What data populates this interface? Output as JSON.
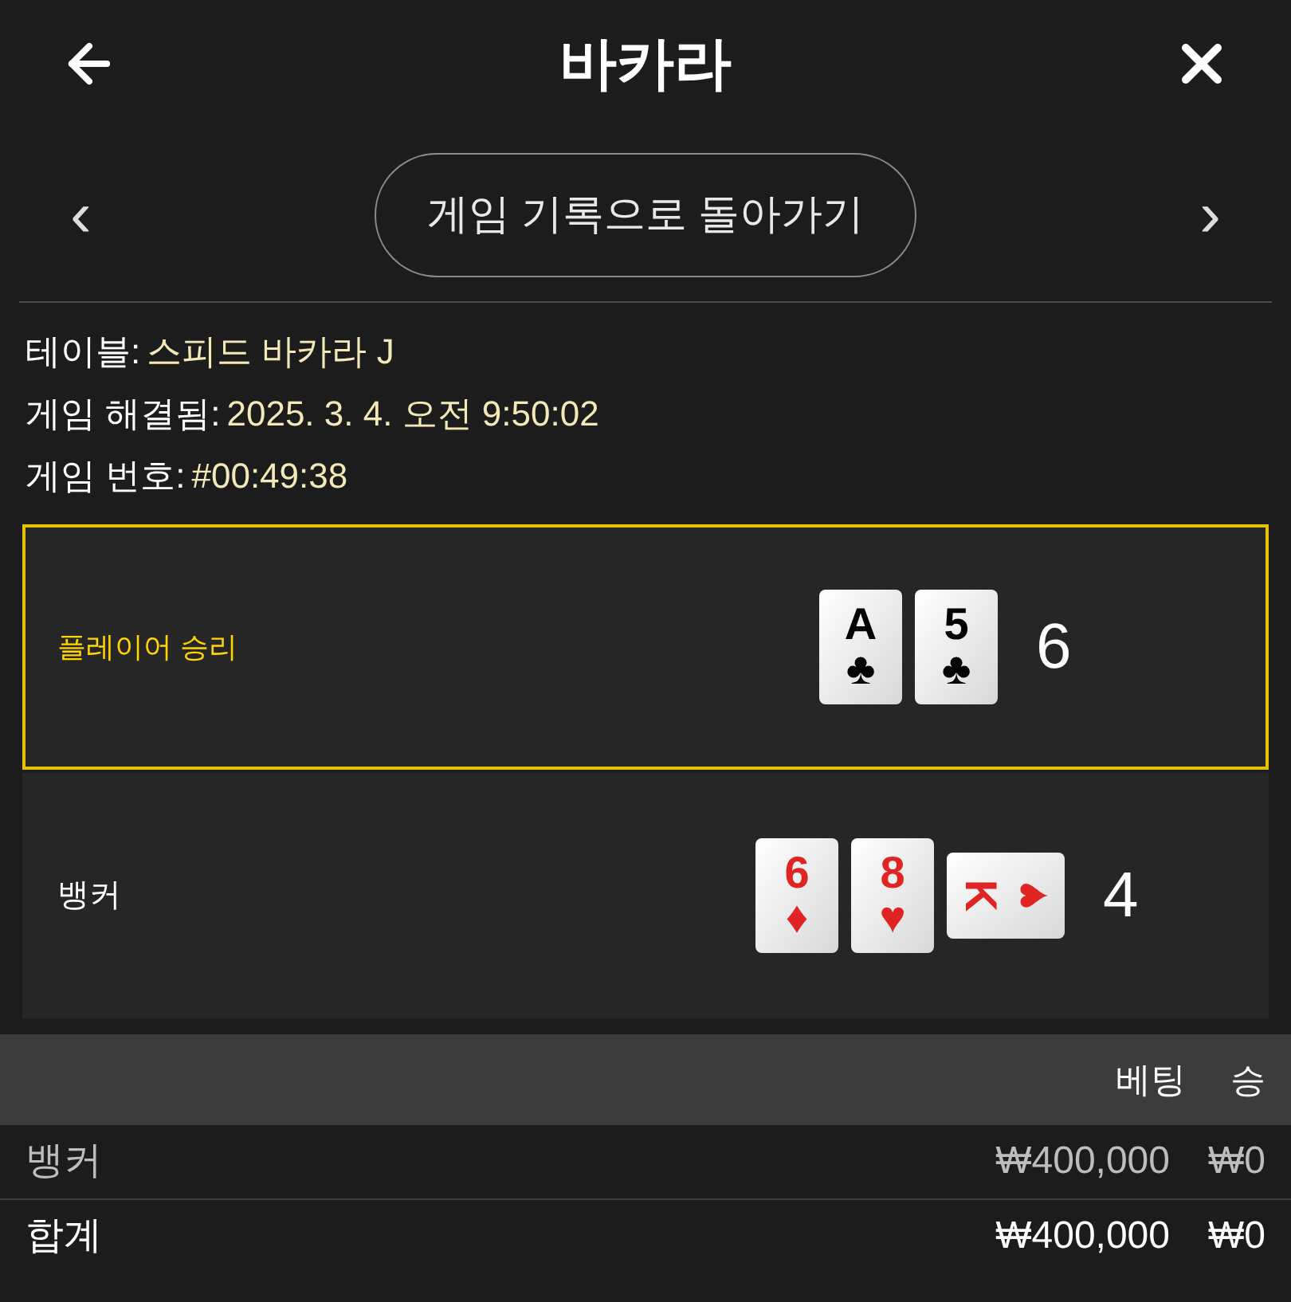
{
  "header": {
    "title": "바카라"
  },
  "nav": {
    "back_label": "게임 기록으로 돌아가기",
    "prev": "‹",
    "next": "›"
  },
  "info": [
    {
      "label": "테이블:",
      "value": "스피드 바카라 J"
    },
    {
      "label": "게임 해결됨:",
      "value": "2025. 3. 4. 오전 9:50:02"
    },
    {
      "label": "게임 번호:",
      "value": "#00:49:38"
    }
  ],
  "hands": [
    {
      "label": "플레이어 승리",
      "winner": true,
      "total": "6",
      "cards": [
        {
          "rank": "A",
          "suit": "♣",
          "color": "#000000",
          "sideways": false
        },
        {
          "rank": "5",
          "suit": "♣",
          "color": "#000000",
          "sideways": false
        }
      ]
    },
    {
      "label": "뱅커",
      "winner": false,
      "total": "4",
      "cards": [
        {
          "rank": "6",
          "suit": "♦",
          "color": "#e02424",
          "sideways": false
        },
        {
          "rank": "8",
          "suit": "♥",
          "color": "#e02424",
          "sideways": false
        },
        {
          "rank": "K",
          "suit": "♥",
          "color": "#e02424",
          "sideways": true
        }
      ]
    }
  ],
  "table": {
    "columns": [
      "베팅",
      "승"
    ],
    "rows": [
      {
        "kind": "item",
        "label": "뱅커",
        "bet": "₩400,000",
        "win": "₩0"
      },
      {
        "kind": "total",
        "label": "합계",
        "bet": "₩400,000",
        "win": "₩0"
      }
    ]
  }
}
